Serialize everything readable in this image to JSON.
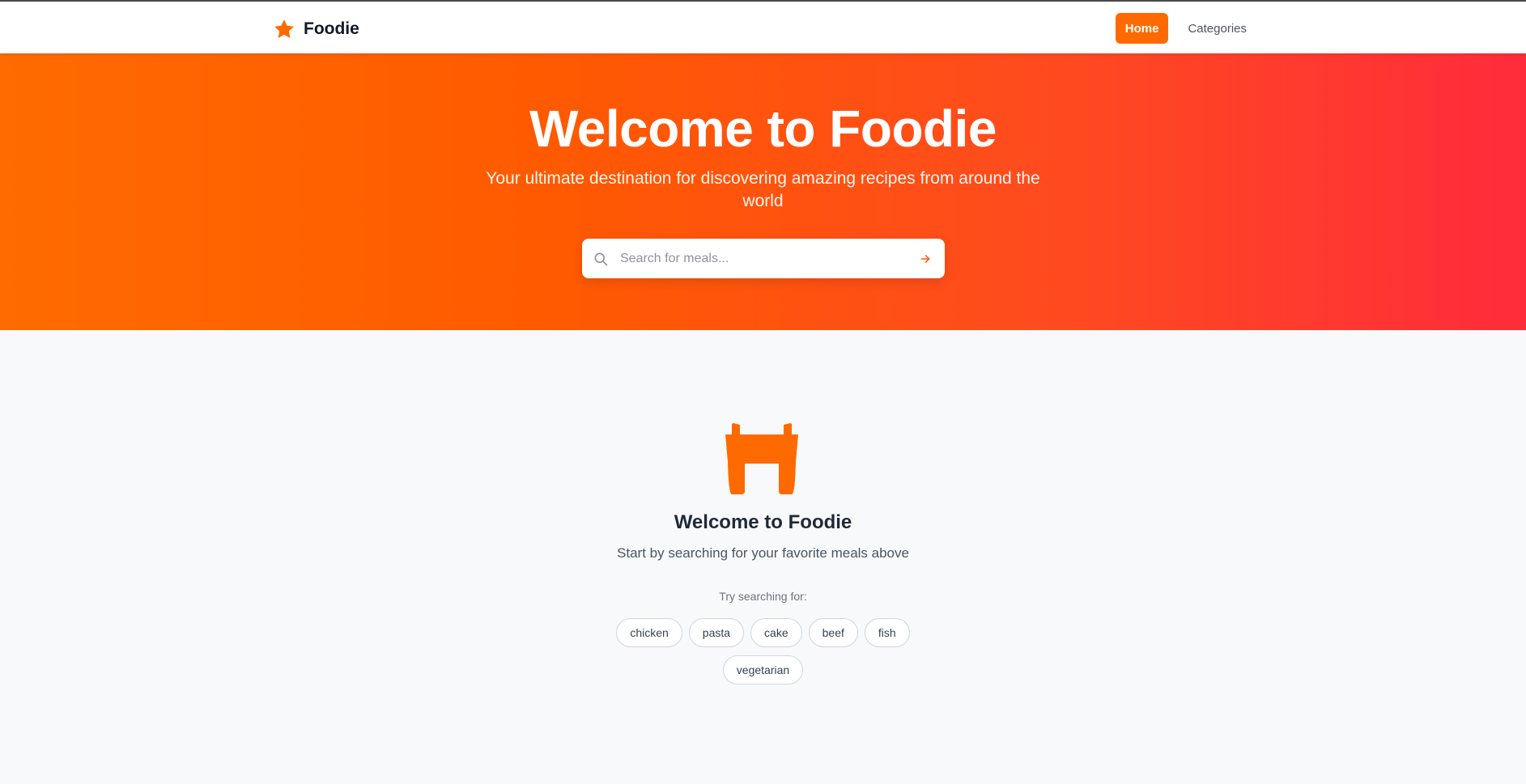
{
  "brand": {
    "name": "Foodie",
    "icon": "star-icon",
    "accent": "#ff6a00"
  },
  "nav": {
    "items": [
      {
        "label": "Home",
        "active": true
      },
      {
        "label": "Categories",
        "active": false
      }
    ]
  },
  "hero": {
    "title": "Welcome to Foodie",
    "subtitle": "Your ultimate destination for discovering amazing recipes from around the world",
    "gradient_start": "#ff6b00",
    "gradient_end": "#ff2b3b",
    "search": {
      "placeholder": "Search for meals...",
      "value": "",
      "search_icon": "search-icon",
      "submit_icon": "arrow-right-icon"
    }
  },
  "empty_state": {
    "icon": "utensils-icon",
    "title": "Welcome to Foodie",
    "subtitle": "Start by searching for your favorite meals above",
    "try_label": "Try searching for:",
    "suggestions": [
      "chicken",
      "pasta",
      "cake",
      "beef",
      "fish",
      "vegetarian"
    ]
  }
}
